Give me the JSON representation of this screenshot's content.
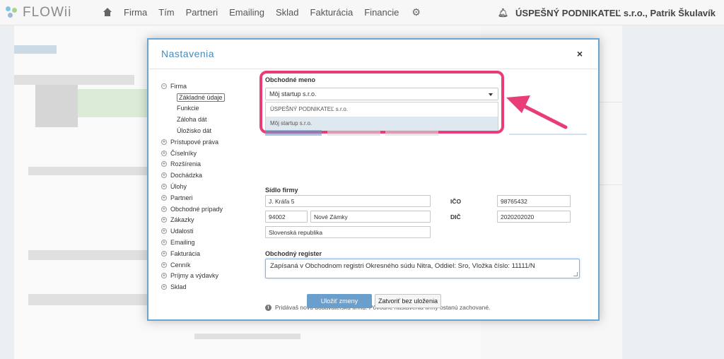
{
  "brand": {
    "name": "FLOWii",
    "colors": {
      "accent": "#4a89b8",
      "highlight": "#e93d7a",
      "primary_button": "#6a9fcd"
    }
  },
  "nav": {
    "items": [
      "Firma",
      "Tím",
      "Partneri",
      "Emailing",
      "Sklad",
      "Fakturácia",
      "Financie"
    ],
    "account": "ÚSPEŠNÝ PODNIKATEĽ s.r.o., Patrik Škulavík"
  },
  "modal": {
    "title": "Nastavenia",
    "close": "×",
    "tree": [
      {
        "label": "Firma",
        "toggle": "−",
        "children": [
          {
            "label": "Základné údaje",
            "active": true
          },
          {
            "label": "Funkcie"
          },
          {
            "label": "Záloha dát"
          },
          {
            "label": "Úložisko dát"
          }
        ]
      },
      {
        "label": "Prístupové práva",
        "toggle": "+"
      },
      {
        "label": "Číselníky",
        "toggle": "+"
      },
      {
        "label": "Rozšírenia",
        "toggle": "+"
      },
      {
        "label": "Dochádzka",
        "toggle": "+"
      },
      {
        "label": "Úlohy",
        "toggle": "+"
      },
      {
        "label": "Partneri",
        "toggle": "+"
      },
      {
        "label": "Obchodné prípady",
        "toggle": "+"
      },
      {
        "label": "Zákazky",
        "toggle": "+"
      },
      {
        "label": "Udalosti",
        "toggle": "+"
      },
      {
        "label": "Emailing",
        "toggle": "+"
      },
      {
        "label": "Fakturácia",
        "toggle": "+"
      },
      {
        "label": "Cenník",
        "toggle": "+"
      },
      {
        "label": "Príjmy a výdavky",
        "toggle": "+"
      },
      {
        "label": "Sklad",
        "toggle": "+"
      }
    ],
    "company_name": {
      "label": "Obchodné meno",
      "selected": "Môj startup s.r.o.",
      "options": [
        "ÚSPEŠNÝ PODNIKATEĽ s.r.o.",
        "Môj startup s.r.o."
      ]
    },
    "address": {
      "label": "Sídlo firmy",
      "street": "J. Kráľa 5",
      "zip": "94002",
      "city": "Nové Zámky",
      "country": "Slovenská republika"
    },
    "ico": {
      "label": "IČO",
      "value": "98765432"
    },
    "dic": {
      "label": "DIČ",
      "value": "2020202020"
    },
    "register": {
      "label": "Obchodný register",
      "value": "Zapísaná v Obchodnom registri Okresného súdu Nitra, Oddiel: Sro, Vložka číslo: 11111/N"
    },
    "info": "Pridávaš novú dodávateľskú firmu. Pôvodné nastavenia firmy ostanú zachované.",
    "buttons": {
      "save": "Uložiť zmeny",
      "close": "Zatvoriť bez uloženia"
    }
  }
}
